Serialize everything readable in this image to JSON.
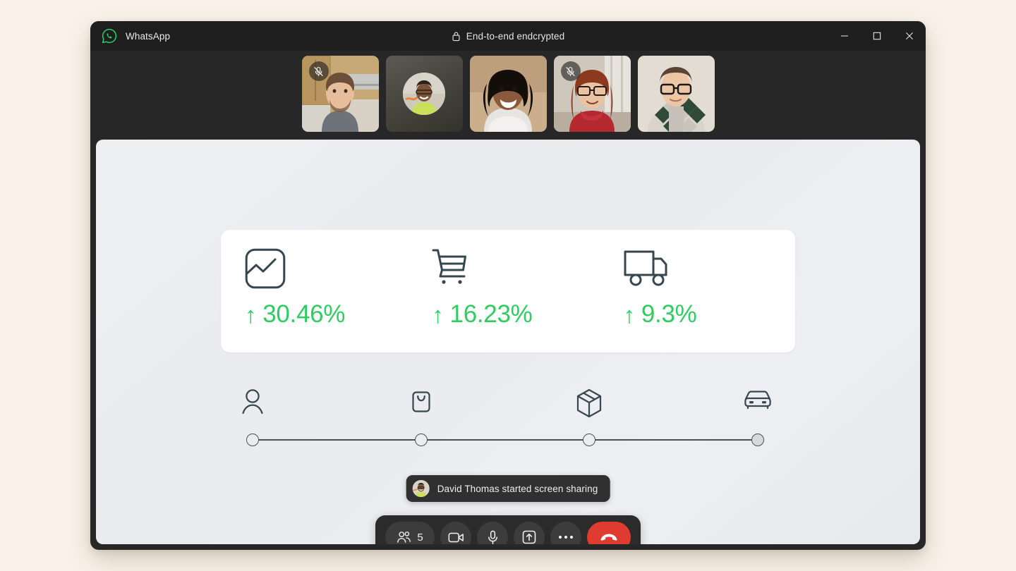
{
  "window": {
    "app_name": "WhatsApp",
    "encryption_label": "End-to-end endcrypted",
    "logo_icon": "whatsapp-logo-icon",
    "lock_icon": "lock-icon",
    "controls": [
      {
        "name": "minimize",
        "icon": "minimize-icon",
        "label": "Minimize"
      },
      {
        "name": "maximize",
        "icon": "maximize-icon",
        "label": "Maximize"
      },
      {
        "name": "close",
        "icon": "close-icon",
        "label": "Close"
      }
    ]
  },
  "participants": [
    {
      "id": "p1",
      "type": "video",
      "muted": true,
      "mute_icon": "mic-off-icon"
    },
    {
      "id": "p2",
      "type": "avatar",
      "muted": false,
      "mute_icon": ""
    },
    {
      "id": "p3",
      "type": "video",
      "muted": false,
      "mute_icon": ""
    },
    {
      "id": "p4",
      "type": "video",
      "muted": true,
      "mute_icon": "mic-off-icon"
    },
    {
      "id": "p5",
      "type": "video",
      "muted": false,
      "mute_icon": ""
    }
  ],
  "shared_screen": {
    "metrics": [
      {
        "icon": "chart-line-icon",
        "arrow": "↑",
        "value": "30.46%"
      },
      {
        "icon": "shopping-cart-icon",
        "arrow": "↑",
        "value": "16.23%"
      },
      {
        "icon": "delivery-truck-icon",
        "arrow": "↑",
        "value": "9.3%"
      }
    ],
    "stepper": {
      "steps": [
        {
          "icon": "user-icon",
          "position": 0,
          "filled": false
        },
        {
          "icon": "shopping-bag-icon",
          "position": 33.33,
          "filled": false
        },
        {
          "icon": "package-box-icon",
          "position": 66.66,
          "filled": false
        },
        {
          "icon": "car-icon",
          "position": 100,
          "filled": true
        }
      ]
    }
  },
  "toast": {
    "avatar_icon": "user-avatar",
    "message": "David Thomas started screen sharing"
  },
  "call_controls": [
    {
      "name": "participants-button",
      "icon": "people-icon",
      "count": "5"
    },
    {
      "name": "camera-button",
      "icon": "video-camera-icon",
      "count": ""
    },
    {
      "name": "microphone-button",
      "icon": "microphone-icon",
      "count": ""
    },
    {
      "name": "share-screen-button",
      "icon": "share-screen-icon",
      "count": ""
    },
    {
      "name": "more-options-button",
      "icon": "ellipsis-icon",
      "count": ""
    },
    {
      "name": "end-call-button",
      "icon": "phone-hangup-icon",
      "count": ""
    }
  ],
  "colors": {
    "page_background": "#FAF2E9",
    "window_chrome": "#272727",
    "titlebar": "#1E1E1E",
    "brand_green": "#25D366",
    "metric_green": "#2ECC61",
    "icon_navy": "#37474F",
    "end_call_red": "#E03B30"
  }
}
